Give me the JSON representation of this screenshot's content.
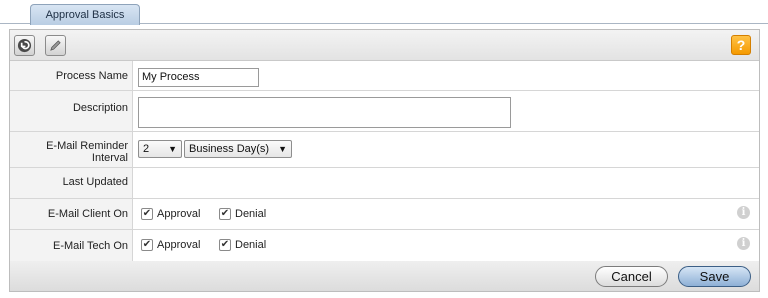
{
  "tabs": [
    {
      "label": "Approval Basics"
    }
  ],
  "toolbar": {
    "back_icon": "back-arrow-icon",
    "edit_icon": "pencil-icon",
    "help_label": "?"
  },
  "form": {
    "process_name": {
      "label": "Process Name",
      "value": "My Process"
    },
    "description": {
      "label": "Description",
      "value": ""
    },
    "reminder": {
      "label_line1": "E-Mail Reminder",
      "label_line2": "Interval",
      "count": "2",
      "unit": "Business Day(s)"
    },
    "last_updated": {
      "label": "Last Updated",
      "value": ""
    },
    "email_client": {
      "label": "E-Mail Client On",
      "approval": "Approval",
      "denial": "Denial",
      "approval_checked": true,
      "denial_checked": true
    },
    "email_tech": {
      "label": "E-Mail Tech On",
      "approval": "Approval",
      "denial": "Denial",
      "approval_checked": true,
      "denial_checked": true
    }
  },
  "footer": {
    "cancel_label": "Cancel",
    "save_label": "Save"
  },
  "colors": {
    "help": "#f59a00",
    "tab": "#c9d9ec",
    "label_bg": "#f3f3f3"
  }
}
